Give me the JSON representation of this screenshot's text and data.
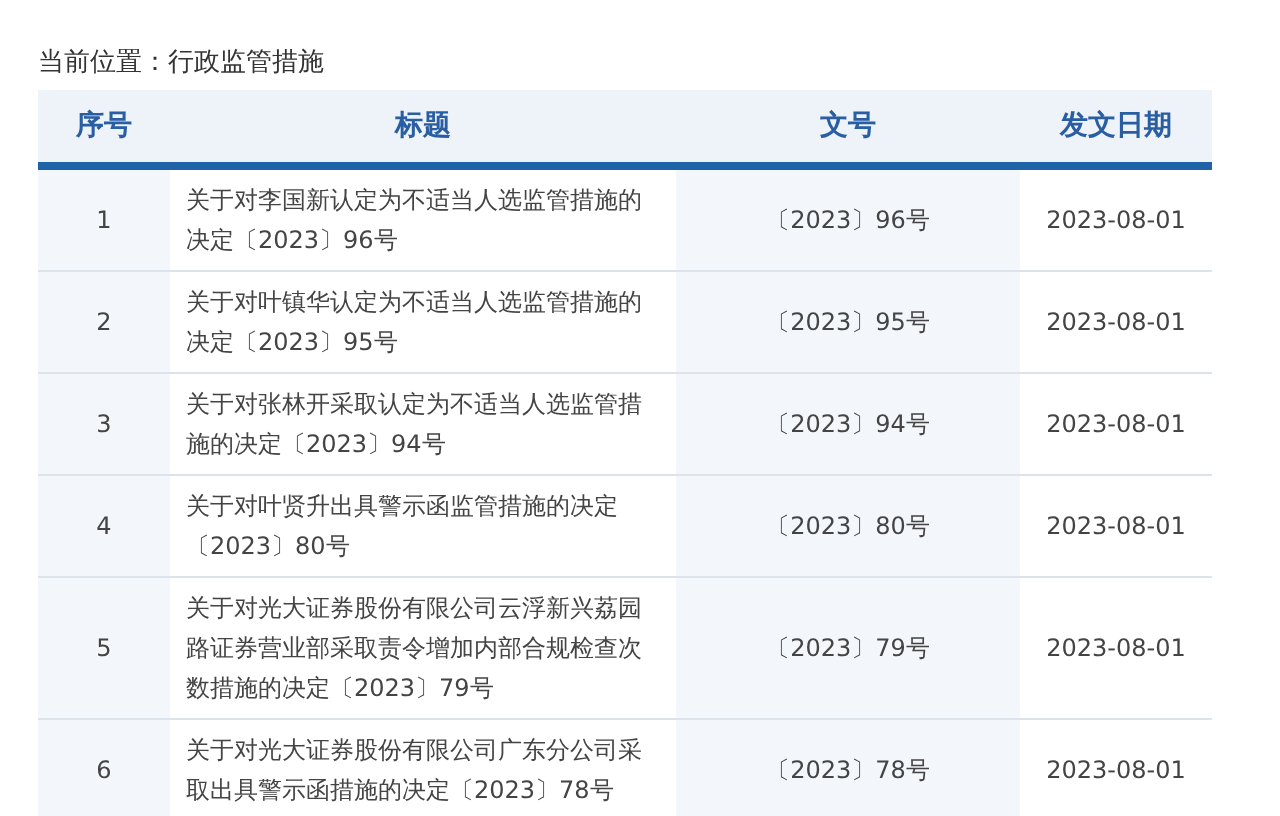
{
  "breadcrumb": "当前位置：行政监管措施",
  "table": {
    "columns": [
      "序号",
      "标题",
      "文号",
      "发文日期"
    ],
    "rows": [
      {
        "index": "1",
        "title": "关于对李国新认定为不适当人选监管措施的决定〔2023〕96号",
        "number": "〔2023〕96号",
        "date": "2023-08-01"
      },
      {
        "index": "2",
        "title": "关于对叶镇华认定为不适当人选监管措施的决定〔2023〕95号",
        "number": "〔2023〕95号",
        "date": "2023-08-01"
      },
      {
        "index": "3",
        "title": "关于对张林开采取认定为不适当人选监管措施的决定〔2023〕94号",
        "number": "〔2023〕94号",
        "date": "2023-08-01"
      },
      {
        "index": "4",
        "title": "关于对叶贤升出具警示函监管措施的决定〔2023〕80号",
        "number": "〔2023〕80号",
        "date": "2023-08-01"
      },
      {
        "index": "5",
        "title": "关于对光大证券股份有限公司云浮新兴荔园路证券营业部采取责令增加内部合规检查次数措施的决定〔2023〕79号",
        "number": "〔2023〕79号",
        "date": "2023-08-01"
      },
      {
        "index": "6",
        "title": "关于对光大证券股份有限公司广东分公司采取出具警示函措施的决定〔2023〕78号",
        "number": "〔2023〕78号",
        "date": "2023-08-01"
      }
    ]
  }
}
